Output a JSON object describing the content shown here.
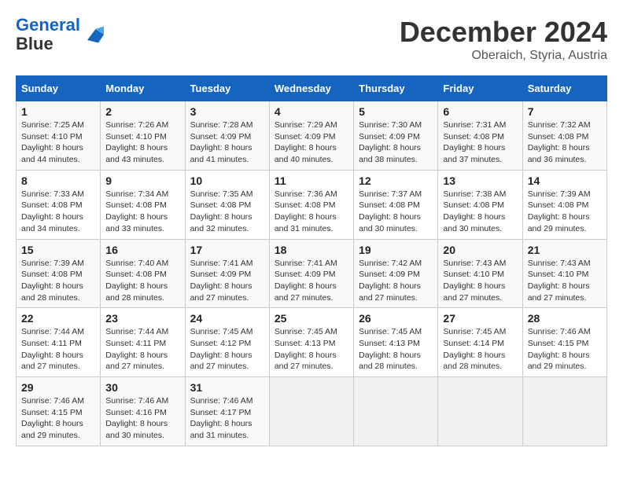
{
  "header": {
    "logo_line1": "General",
    "logo_line2": "Blue",
    "month": "December 2024",
    "location": "Oberaich, Styria, Austria"
  },
  "days_of_week": [
    "Sunday",
    "Monday",
    "Tuesday",
    "Wednesday",
    "Thursday",
    "Friday",
    "Saturday"
  ],
  "weeks": [
    [
      {
        "day": "1",
        "info": "Sunrise: 7:25 AM\nSunset: 4:10 PM\nDaylight: 8 hours and 44 minutes."
      },
      {
        "day": "2",
        "info": "Sunrise: 7:26 AM\nSunset: 4:10 PM\nDaylight: 8 hours and 43 minutes."
      },
      {
        "day": "3",
        "info": "Sunrise: 7:28 AM\nSunset: 4:09 PM\nDaylight: 8 hours and 41 minutes."
      },
      {
        "day": "4",
        "info": "Sunrise: 7:29 AM\nSunset: 4:09 PM\nDaylight: 8 hours and 40 minutes."
      },
      {
        "day": "5",
        "info": "Sunrise: 7:30 AM\nSunset: 4:09 PM\nDaylight: 8 hours and 38 minutes."
      },
      {
        "day": "6",
        "info": "Sunrise: 7:31 AM\nSunset: 4:08 PM\nDaylight: 8 hours and 37 minutes."
      },
      {
        "day": "7",
        "info": "Sunrise: 7:32 AM\nSunset: 4:08 PM\nDaylight: 8 hours and 36 minutes."
      }
    ],
    [
      {
        "day": "8",
        "info": "Sunrise: 7:33 AM\nSunset: 4:08 PM\nDaylight: 8 hours and 34 minutes."
      },
      {
        "day": "9",
        "info": "Sunrise: 7:34 AM\nSunset: 4:08 PM\nDaylight: 8 hours and 33 minutes."
      },
      {
        "day": "10",
        "info": "Sunrise: 7:35 AM\nSunset: 4:08 PM\nDaylight: 8 hours and 32 minutes."
      },
      {
        "day": "11",
        "info": "Sunrise: 7:36 AM\nSunset: 4:08 PM\nDaylight: 8 hours and 31 minutes."
      },
      {
        "day": "12",
        "info": "Sunrise: 7:37 AM\nSunset: 4:08 PM\nDaylight: 8 hours and 30 minutes."
      },
      {
        "day": "13",
        "info": "Sunrise: 7:38 AM\nSunset: 4:08 PM\nDaylight: 8 hours and 30 minutes."
      },
      {
        "day": "14",
        "info": "Sunrise: 7:39 AM\nSunset: 4:08 PM\nDaylight: 8 hours and 29 minutes."
      }
    ],
    [
      {
        "day": "15",
        "info": "Sunrise: 7:39 AM\nSunset: 4:08 PM\nDaylight: 8 hours and 28 minutes."
      },
      {
        "day": "16",
        "info": "Sunrise: 7:40 AM\nSunset: 4:08 PM\nDaylight: 8 hours and 28 minutes."
      },
      {
        "day": "17",
        "info": "Sunrise: 7:41 AM\nSunset: 4:09 PM\nDaylight: 8 hours and 27 minutes."
      },
      {
        "day": "18",
        "info": "Sunrise: 7:41 AM\nSunset: 4:09 PM\nDaylight: 8 hours and 27 minutes."
      },
      {
        "day": "19",
        "info": "Sunrise: 7:42 AM\nSunset: 4:09 PM\nDaylight: 8 hours and 27 minutes."
      },
      {
        "day": "20",
        "info": "Sunrise: 7:43 AM\nSunset: 4:10 PM\nDaylight: 8 hours and 27 minutes."
      },
      {
        "day": "21",
        "info": "Sunrise: 7:43 AM\nSunset: 4:10 PM\nDaylight: 8 hours and 27 minutes."
      }
    ],
    [
      {
        "day": "22",
        "info": "Sunrise: 7:44 AM\nSunset: 4:11 PM\nDaylight: 8 hours and 27 minutes."
      },
      {
        "day": "23",
        "info": "Sunrise: 7:44 AM\nSunset: 4:11 PM\nDaylight: 8 hours and 27 minutes."
      },
      {
        "day": "24",
        "info": "Sunrise: 7:45 AM\nSunset: 4:12 PM\nDaylight: 8 hours and 27 minutes."
      },
      {
        "day": "25",
        "info": "Sunrise: 7:45 AM\nSunset: 4:13 PM\nDaylight: 8 hours and 27 minutes."
      },
      {
        "day": "26",
        "info": "Sunrise: 7:45 AM\nSunset: 4:13 PM\nDaylight: 8 hours and 28 minutes."
      },
      {
        "day": "27",
        "info": "Sunrise: 7:45 AM\nSunset: 4:14 PM\nDaylight: 8 hours and 28 minutes."
      },
      {
        "day": "28",
        "info": "Sunrise: 7:46 AM\nSunset: 4:15 PM\nDaylight: 8 hours and 29 minutes."
      }
    ],
    [
      {
        "day": "29",
        "info": "Sunrise: 7:46 AM\nSunset: 4:15 PM\nDaylight: 8 hours and 29 minutes."
      },
      {
        "day": "30",
        "info": "Sunrise: 7:46 AM\nSunset: 4:16 PM\nDaylight: 8 hours and 30 minutes."
      },
      {
        "day": "31",
        "info": "Sunrise: 7:46 AM\nSunset: 4:17 PM\nDaylight: 8 hours and 31 minutes."
      },
      null,
      null,
      null,
      null
    ]
  ]
}
